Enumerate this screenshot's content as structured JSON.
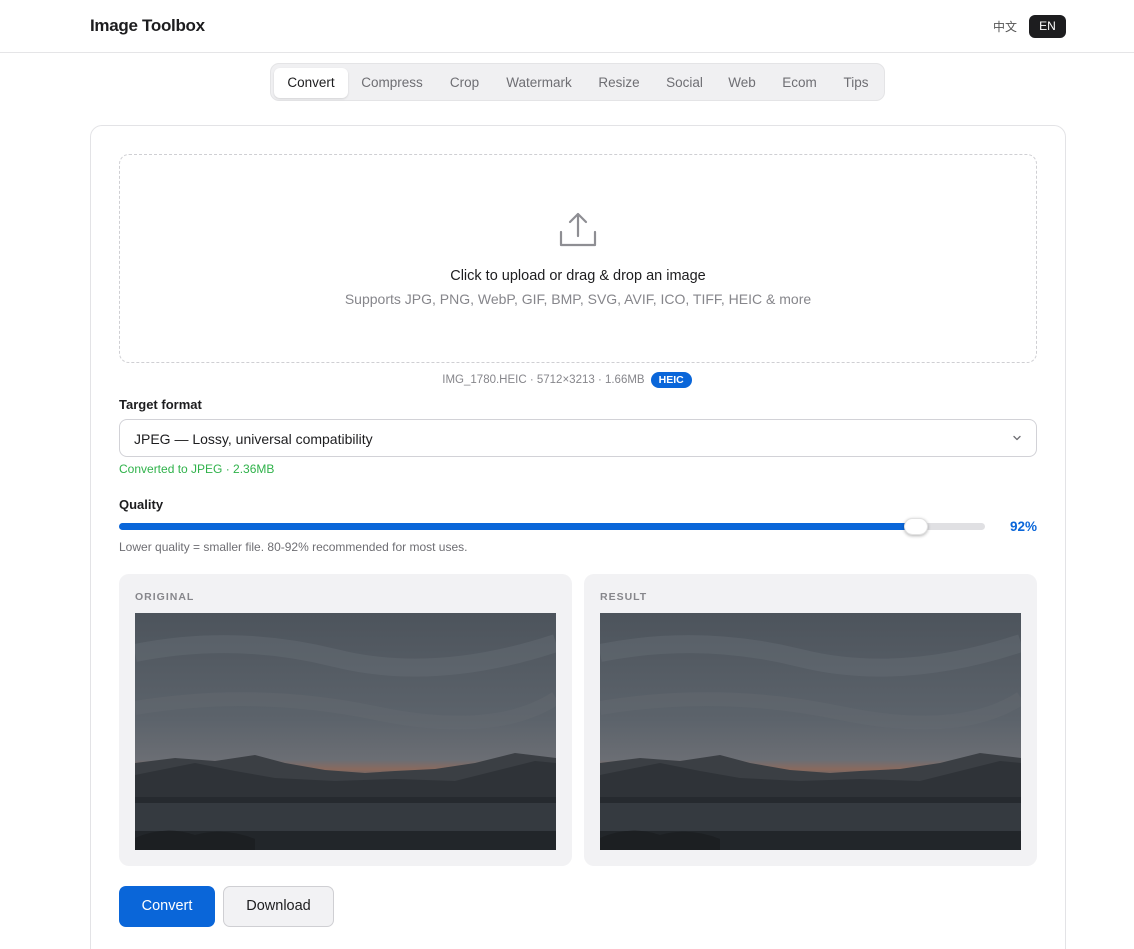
{
  "header": {
    "title": "Image Toolbox",
    "lang_zh": "中文",
    "lang_en": "EN"
  },
  "tabs": [
    {
      "label": "Convert",
      "active": true
    },
    {
      "label": "Compress"
    },
    {
      "label": "Crop"
    },
    {
      "label": "Watermark"
    },
    {
      "label": "Resize"
    },
    {
      "label": "Social"
    },
    {
      "label": "Web"
    },
    {
      "label": "Ecom"
    },
    {
      "label": "Tips"
    }
  ],
  "upload": {
    "icon": "upload-icon",
    "title": "Click to upload or drag & drop an image",
    "subtitle": "Supports JPG, PNG, WebP, GIF, BMP, SVG, AVIF, ICO, TIFF, HEIC & more"
  },
  "file": {
    "info": "IMG_1780.HEIC · 5712×3213 · 1.66MB",
    "badge": "HEIC"
  },
  "format": {
    "label": "Target format",
    "selected": "JPEG — Lossy, universal compatibility",
    "status": "Converted to JPEG · 2.36MB"
  },
  "quality": {
    "label": "Quality",
    "value": 92,
    "display": "92%",
    "hint": "Lower quality = smaller file. 80-92% recommended for most uses."
  },
  "preview": {
    "original_label": "ORIGINAL",
    "result_label": "RESULT"
  },
  "actions": {
    "convert": "Convert",
    "download": "Download"
  },
  "colors": {
    "accent": "#0a66d9",
    "success": "#2fb24a"
  }
}
